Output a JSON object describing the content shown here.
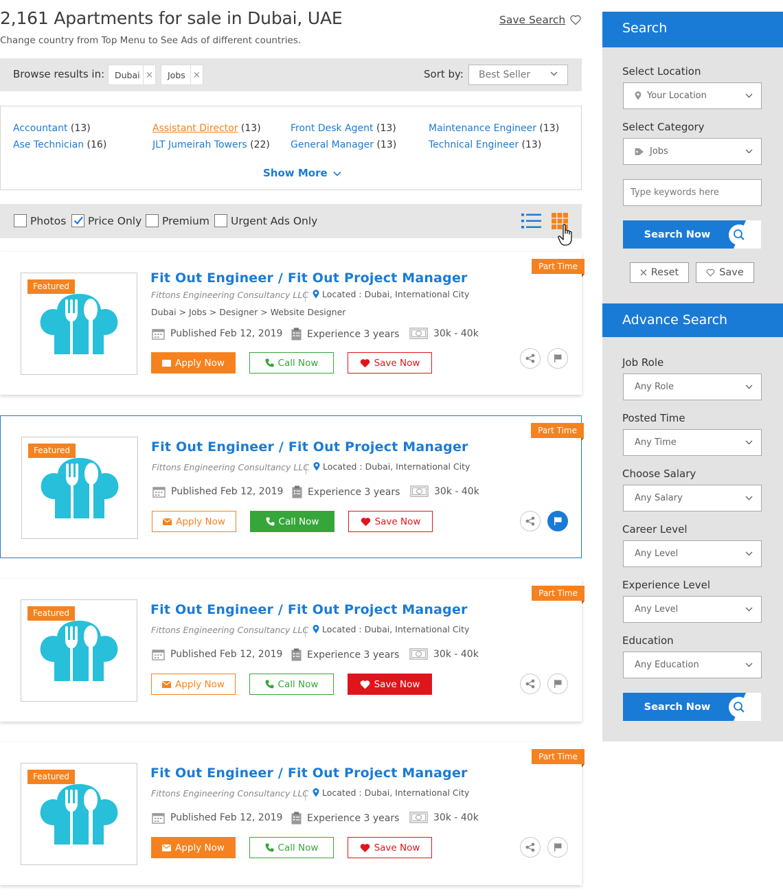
{
  "header": {
    "title": "2,161 Apartments for sale in Dubai, UAE",
    "subtitle": "Change country from Top Menu to See Ads of different countries.",
    "save_search": "Save Search"
  },
  "browse": {
    "label": "Browse results in:",
    "chips": [
      "Dubai",
      "Jobs"
    ],
    "chip_close": "×",
    "sort_label": "Sort by:",
    "sort_value": "Best Seller"
  },
  "categories": [
    {
      "name": "Accountant",
      "count": "(13)"
    },
    {
      "name": "Ase Technician",
      "count": "(16)"
    },
    {
      "name": "Assistant Director",
      "count": "(13)"
    },
    {
      "name": "JLT Jumeirah Towers",
      "count": "(22)"
    },
    {
      "name": "Front Desk Agent",
      "count": "(13)"
    },
    {
      "name": "General Manager",
      "count": "(13)"
    },
    {
      "name": "Maintenance Engineer",
      "count": "(13)"
    },
    {
      "name": "Technical Engineer",
      "count": "(13)"
    }
  ],
  "show_more": "Show More",
  "filters": [
    {
      "label": "Photos",
      "checked": false
    },
    {
      "label": "Price Only",
      "checked": true
    },
    {
      "label": "Premium",
      "checked": false
    },
    {
      "label": "Urgent Ads Only",
      "checked": false
    }
  ],
  "listings": [
    {
      "badge": "Featured",
      "type": "Part Time",
      "title": "Fit Out Engineer / Fit Out Project Manager",
      "company": "Fittons Engineering Consultancy LLC",
      "location": "Located : Dubai, International City",
      "breadcrumb": "Dubai > Jobs > Designer > Website Designer",
      "published": "Published Feb 12, 2019",
      "experience": "Experience 3 years",
      "salary": "30k - 40k",
      "apply": "Apply Now",
      "call": "Call Now",
      "save": "Save Now"
    },
    {
      "badge": "Featured",
      "type": "Part Time",
      "title": "Fit Out Engineer / Fit Out Project Manager",
      "company": "Fittons Engineering Consultancy LLC",
      "location": "Located : Dubai, International City",
      "published": "Published Feb 12, 2019",
      "experience": "Experience 3 years",
      "salary": "30k - 40k",
      "apply": "Apply Now",
      "call": "Call Now",
      "save": "Save Now"
    },
    {
      "badge": "Featured",
      "type": "Part Time",
      "title": "Fit Out Engineer / Fit Out Project Manager",
      "company": "Fittons Engineering Consultancy LLC",
      "location": "Located : Dubai, International City",
      "published": "Published Feb 12, 2019",
      "experience": "Experience 3 years",
      "salary": "30k - 40k",
      "apply": "Apply Now",
      "call": "Call Now",
      "save": "Save Now"
    },
    {
      "badge": "Featured",
      "type": "Part Time",
      "title": "Fit Out Engineer / Fit Out Project Manager",
      "company": "Fittons Engineering Consultancy LLC",
      "location": "Located : Dubai, International City",
      "published": "Published Feb 12, 2019",
      "experience": "Experience 3 years",
      "salary": "30k - 40k",
      "apply": "Apply Now",
      "call": "Call Now",
      "save": "Save Now"
    }
  ],
  "sidebar": {
    "search": {
      "heading": "Search",
      "location_label": "Select Location",
      "location_value": "Your Location",
      "category_label": "Select Category",
      "category_value": "Jobs",
      "keywords_placeholder": "Type keywords here",
      "search_button": "Search Now",
      "reset": "Reset",
      "save": "Save"
    },
    "advance": {
      "heading": "Advance Search",
      "fields": [
        {
          "label": "Job Role",
          "value": "Any Role"
        },
        {
          "label": "Posted Time",
          "value": "Any Time"
        },
        {
          "label": "Choose Salary",
          "value": "Any Salary"
        },
        {
          "label": "Career Level",
          "value": "Any Level"
        },
        {
          "label": "Experience Level",
          "value": "Any Level"
        },
        {
          "label": "Education",
          "value": "Any Education"
        }
      ],
      "search_button": "Search Now"
    }
  },
  "colors": {
    "accent_blue": "#1a7bd6",
    "orange": "#f5821f",
    "green": "#36a63a",
    "red": "#e0151b",
    "icon_teal": "#27bfd9"
  },
  "icons": [
    "heart-icon",
    "chevron-down-icon",
    "list-view-icon",
    "grid-view-icon",
    "hand-cursor-icon",
    "food-icon",
    "map-pin-icon",
    "calendar-icon",
    "clipboard-icon",
    "money-icon",
    "envelope-icon",
    "phone-icon",
    "share-icon",
    "flag-icon",
    "search-icon",
    "close-icon",
    "tag-icon"
  ]
}
